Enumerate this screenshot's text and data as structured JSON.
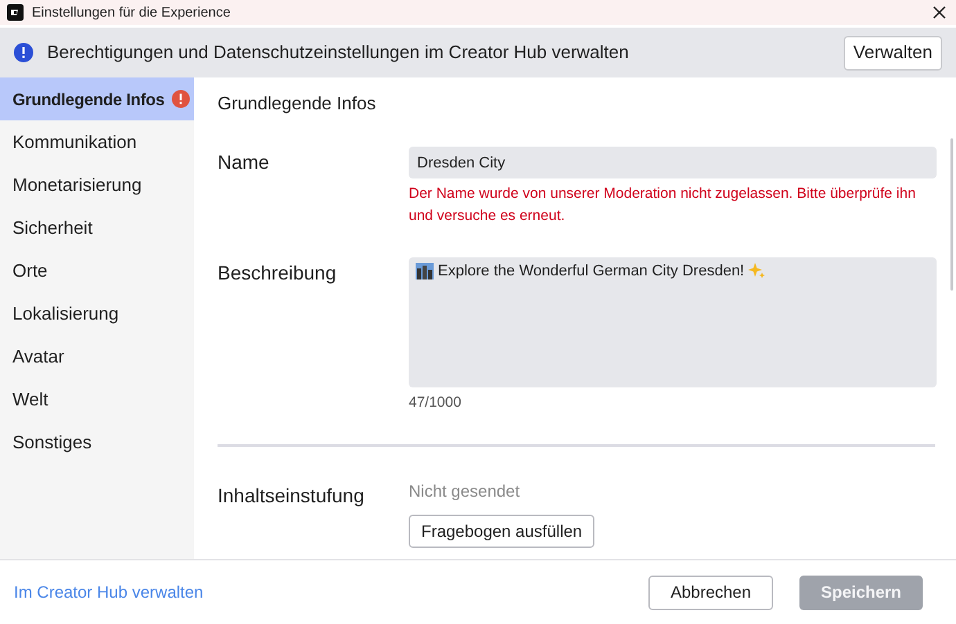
{
  "window": {
    "title": "Einstellungen für die Experience"
  },
  "banner": {
    "text": "Berechtigungen und Datenschutzeinstellungen im Creator Hub verwalten",
    "button": "Verwalten"
  },
  "sidebar": {
    "items": [
      {
        "label": "Grundlegende Infos",
        "selected": true,
        "error": true
      },
      {
        "label": "Kommunikation",
        "selected": false,
        "error": false
      },
      {
        "label": "Monetarisierung",
        "selected": false,
        "error": false
      },
      {
        "label": "Sicherheit",
        "selected": false,
        "error": false
      },
      {
        "label": "Orte",
        "selected": false,
        "error": false
      },
      {
        "label": "Lokalisierung",
        "selected": false,
        "error": false
      },
      {
        "label": "Avatar",
        "selected": false,
        "error": false
      },
      {
        "label": "Welt",
        "selected": false,
        "error": false
      },
      {
        "label": "Sonstiges",
        "selected": false,
        "error": false
      }
    ]
  },
  "main": {
    "heading": "Grundlegende Infos",
    "name": {
      "label": "Name",
      "value": "Dresden City",
      "error": "Der Name wurde von unserer Moderation nicht zugelassen. Bitte überprüfe ihn und versuche es erneut."
    },
    "description": {
      "label": "Beschreibung",
      "value": "Explore the Wonderful German City Dresden!",
      "counter": "47/1000"
    },
    "rating": {
      "label": "Inhaltseinstufung",
      "status": "Nicht gesendet",
      "button": "Fragebogen ausfüllen"
    }
  },
  "footer": {
    "link": "Im Creator Hub verwalten",
    "cancel": "Abbrechen",
    "save": {
      "label": "Speichern",
      "disabled": true
    }
  }
}
